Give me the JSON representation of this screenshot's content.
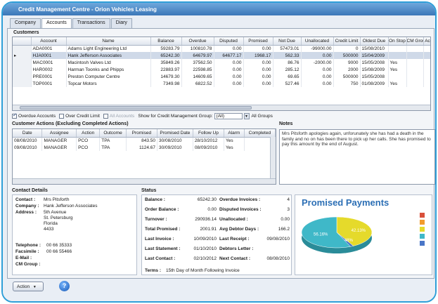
{
  "window": {
    "title": "Credit Management Centre - Orion Vehicles Leasing"
  },
  "tabs": [
    {
      "label": "Company"
    },
    {
      "label": "Accounts"
    },
    {
      "label": "Transactions"
    },
    {
      "label": "Diary"
    }
  ],
  "customers": {
    "title": "Customers",
    "columns": [
      "Account",
      "Name",
      "Balance",
      "Overdue",
      "Disputed",
      "Promised",
      "Not Due",
      "Unallocated",
      "Credit Limit",
      "Oldest Due",
      "On Stop",
      "CM Group",
      "Ac"
    ],
    "rows": [
      [
        "ADA0001",
        "Adams Light Engineering Ltd",
        "59283.79",
        "100810.78",
        "0.00",
        "0.00",
        "57473.01",
        "-99000.00",
        "0",
        "15/08/2010",
        "",
        "",
        ""
      ],
      [
        "HJA0001",
        "Hank Jefferson Associates",
        "65242.30",
        "64679.97",
        "64677.17",
        "1968.17",
        "562.33",
        "0.00",
        "500000",
        "15/04/2009",
        "",
        "",
        ""
      ],
      [
        "MAC0001",
        "Macintosh Valves Ltd",
        "35849.26",
        "37562.50",
        "0.00",
        "0.00",
        "86.76",
        "-2000.00",
        "9000",
        "15/05/2008",
        "Yes",
        "",
        ""
      ],
      [
        "HAR0002",
        "Harman Toonks and Phipps",
        "22883.97",
        "22598.85",
        "0.00",
        "0.00",
        "285.12",
        "0.00",
        "2000",
        "15/08/2009",
        "Yes",
        "",
        ""
      ],
      [
        "PRE0001",
        "Preston Computer Centre",
        "14679.30",
        "14609.65",
        "0.00",
        "0.00",
        "69.65",
        "0.00",
        "500000",
        "15/05/2008",
        "",
        "",
        ""
      ],
      [
        "TOP0001",
        "Topcar Motors",
        "7349.98",
        "6822.52",
        "0.00",
        "0.00",
        "527.46",
        "0.00",
        "750",
        "01/08/2009",
        "Yes",
        "",
        ""
      ]
    ]
  },
  "filters": {
    "overdue_accounts": "Overdue Accounts",
    "over_credit_limit": "Over Credit Limit",
    "all_accounts": "All Accounts",
    "show_group_label": "Show for Credit Management Group:",
    "group_value": "(All)",
    "all_groups": "All Groups"
  },
  "actions": {
    "title": "Customer Actions (Excluding Completed Actions)",
    "columns": [
      "Date",
      "Assignee",
      "Action",
      "Outcome",
      "Promised",
      "Promised Date",
      "Follow Up",
      "Alarm",
      "Completed"
    ],
    "rows": [
      [
        "08/08/2010",
        "MANAGER",
        "PCO",
        "TPA",
        "843.50",
        "30/08/2010",
        "28/10/2012",
        "Yes",
        ""
      ],
      [
        "09/08/2010",
        "MANAGER",
        "PCO",
        "TPA",
        "1124.67",
        "30/09/2010",
        "08/09/2010",
        "Yes",
        ""
      ]
    ]
  },
  "notes": {
    "title": "Notes",
    "text": "Mrs Pitsforth apologies again, unforunately she has had a death in the family and no on has been there to pick up her calls. She has promised to pay this amount by the end of August."
  },
  "contact": {
    "title": "Contact Details",
    "contact_label": "Contact :",
    "contact_value": "Mrs Pitsforth",
    "company_label": "Company :",
    "company_value": "Hank Jefferson Associates",
    "address_label": "Address :",
    "address_lines": [
      "5th Avenue",
      "St. Petersburg",
      "Florida",
      "4433"
    ],
    "telephone_label": "Telephone :",
    "telephone_value": "00 66 35333",
    "facsimile_label": "Facsimile :",
    "facsimile_value": "00 66 55466",
    "email_label": "E-Mail :",
    "cmgroup_label": "CM Group :"
  },
  "status": {
    "title": "Status",
    "left": [
      {
        "label": "Balance :",
        "value": "65242.30"
      },
      {
        "label": "Order Balance :",
        "value": "0.00"
      },
      {
        "label": "Turnover :",
        "value": "290936.14"
      },
      {
        "label": "Total Promised :",
        "value": "2001.91"
      },
      {
        "label": "Last Invoice :",
        "value": "10/09/2010"
      },
      {
        "label": "Last Statement :",
        "value": "01/10/2010"
      },
      {
        "label": "Last Contact :",
        "value": "02/10/2012"
      }
    ],
    "right": [
      {
        "label": "Overdue Invoices :",
        "value": "4"
      },
      {
        "label": "Disputed Invoices :",
        "value": "3"
      },
      {
        "label": "Unallocated :",
        "value": "0.00"
      },
      {
        "label": "Avg Debtor Days :",
        "value": "166.2"
      },
      {
        "label": "Last Receipt :",
        "value": "09/08/2010"
      },
      {
        "label": "Debtors Letter :",
        "value": ""
      },
      {
        "label": "Next Contact :",
        "value": "08/08/2010"
      }
    ],
    "terms_label": "Terms :",
    "terms_value": "15th Day of Month Following Invoice"
  },
  "promised_chart": {
    "title": "Promised Payments",
    "slices": [
      {
        "label": "42.13%",
        "value": 42.13,
        "color": "#e5da2b"
      },
      {
        "label": "1.48%",
        "value": 1.48,
        "color": "#4a76c7"
      },
      {
        "label": "56.16%",
        "value": 56.39,
        "color": "#3fb8c8"
      }
    ],
    "legend_colors": [
      "#d9503a",
      "#f29b2c",
      "#e5da2b",
      "#3fb8c8",
      "#4a76c7"
    ]
  },
  "footer": {
    "action_label": "Action",
    "help_symbol": "?"
  },
  "colors": {
    "accent": "#2f9fd8",
    "selected_row": "#cfd9e8"
  }
}
